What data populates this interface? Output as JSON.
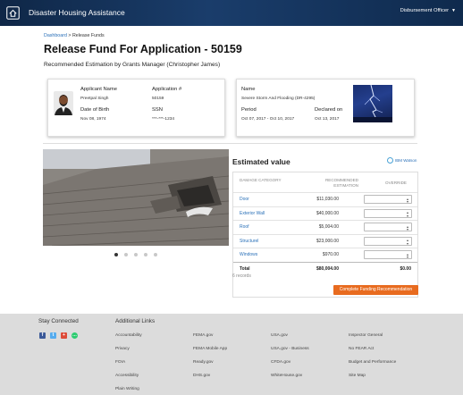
{
  "header": {
    "app_title": "Disaster Housing Assistance",
    "user_role": "Disbursement Officer"
  },
  "breadcrumb": {
    "home": "Dashboard",
    "separator": ">",
    "current": "Release Funds"
  },
  "page": {
    "title": "Release Fund For Application - 50159",
    "subtitle": "Recommended Estimation by Grants Manager (Christopher James)"
  },
  "applicant": {
    "name_label": "Applicant Name",
    "name": "Preetpal Singh",
    "app_label": "Application #",
    "app_no": "50159",
    "dob_label": "Date of Birth",
    "dob": "Nov 08, 1974",
    "ssn_label": "SSN",
    "ssn": "***-***-1234"
  },
  "disaster": {
    "name_label": "Name",
    "name": "Severe Storm And Flooding (DR-4295)",
    "period_label": "Period",
    "period": "Oct 07, 2017 - Oct 10, 2017",
    "declared_label": "Declared on",
    "declared": "Oct 13, 2017"
  },
  "estimate": {
    "title": "Estimated value",
    "watson_label": "IBM Watson",
    "headers": {
      "category": "DAMAGE CATEGORY",
      "recommended": "RECOMMENDED ESTIMATION",
      "override": "OVERRIDE"
    },
    "rows": [
      {
        "category": "Door",
        "amount": "$11,030.00"
      },
      {
        "category": "Exterior Wall",
        "amount": "$40,000.00"
      },
      {
        "category": "Roof",
        "amount": "$5,004.00"
      },
      {
        "category": "Structurel",
        "amount": "$23,000.00"
      },
      {
        "category": "Windows",
        "amount": "$970.00"
      }
    ],
    "total_label": "Total",
    "total_amount": "$80,004.00",
    "total_override": "$0.00",
    "records": "6 records",
    "button": "Complete Funding Recommendation"
  },
  "carousel": {
    "count": 5,
    "active": 0
  },
  "footer": {
    "stay_connected": "Stay Connected",
    "additional_links": "Additional Links",
    "social_icons": [
      "facebook-icon",
      "twitter-icon",
      "google-plus-icon",
      "chat-icon"
    ],
    "colors": {
      "facebook": "#3b5998",
      "twitter": "#55acee",
      "google": "#dd4b39",
      "chat": "#2ecc71"
    },
    "columns": [
      [
        "Accountability",
        "Privacy",
        "FOIA",
        "Accessibility",
        "Plain Writing"
      ],
      [
        "FEMA.gov",
        "FEMA Mobile App",
        "Ready.gov",
        "DHS.gov"
      ],
      [
        "USA.gov",
        "USA.gov - Business",
        "CFDA.gov",
        "WhiteHouse.gov"
      ],
      [
        "Inspector General",
        "No FEAR Act",
        "Budget and Performance",
        "Site Map"
      ]
    ]
  },
  "colors": {
    "header_bg": "#0f2747",
    "link": "#2a70b8",
    "button": "#e86b1f"
  }
}
